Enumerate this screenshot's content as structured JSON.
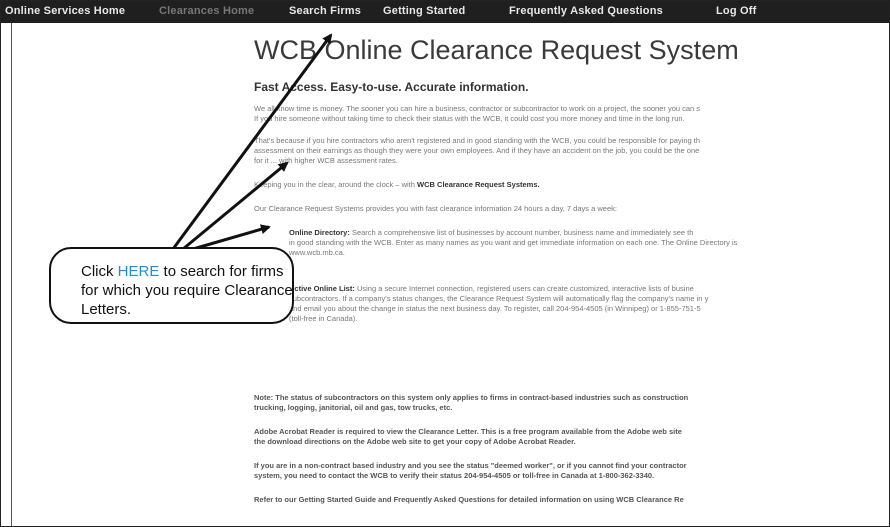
{
  "nav": {
    "items": [
      {
        "label": "Online Services Home",
        "active": false
      },
      {
        "label": "Clearances Home",
        "active": true
      },
      {
        "label": "Search Firms",
        "active": false
      },
      {
        "label": "Getting Started",
        "active": false
      },
      {
        "label": "Frequently Asked Questions",
        "active": false
      },
      {
        "label": "Log Off",
        "active": false
      }
    ]
  },
  "page": {
    "title": "WCB Online Clearance Request System",
    "subtitle": "Fast Access. Easy-to-use. Accurate information.",
    "p1": [
      "We all know time is money. The sooner you can hire a business, contractor or subcontractor to work on a project, the sooner you can s",
      "If you hire someone without taking time to check their status with the WCB, it could cost you more money and time in the long run."
    ],
    "p2": [
      "That's because if you hire contractors who aren't registered and in good standing with the WCB, you could be responsible for paying th",
      "assessment on their earnings as though they were your own employees. And if they have an accident on the job, you could be the one",
      "for it ... with higher WCB assessment rates."
    ],
    "p3_prefix": "Keeping you in the clear, around the clock – with ",
    "p3_bold": "WCB Clearance Request Systems.",
    "p4": "Our Clearance Request Systems provides you with fast clearance information 24 hours a day, 7 days a week:",
    "p5_bold": "Online Directory:",
    "p5": [
      " Search a comprehensive list of businesses by account number, business name and immediately see th",
      "in good standing with the WCB. Enter as many names as you want and get immediate information on each one. The Online Directory is",
      "www.wcb.mb.ca."
    ],
    "p6_bold": "Active Online List:",
    "p6": [
      " Using a secure Internet connection, registered users can create customized, interactive lists of busine",
      "subcontractors. If a company's status changes, the Clearance Request System will automatically flag the company's name in y",
      "and email you about the change in status the next business day. To register, call 204-954-4505 (in Winnipeg) or 1-855-751-5",
      "(toll-free in Canada)."
    ],
    "note": [
      "Note: The status of subcontractors on this system only applies to firms in contract-based industries such as construction",
      "trucking, logging, janitorial, oil and gas, tow trucks, etc."
    ],
    "adobe": [
      "Adobe Acrobat Reader is required to view the Clearance Letter. This is a free program available from the Adobe web site",
      "the download directions on the Adobe web site to get your copy of Adobe Acrobat Reader."
    ],
    "noncontract": [
      "If you are in a non-contract based industry and you see the status \"deemed worker\", or if you cannot find your contractor",
      "system, you need to contact the WCB to verify their status 204-954-4505 or toll-free in Canada at 1-800-362-3340."
    ],
    "refer": "Refer to our Getting Started Guide and Frequently Asked Questions for detailed information on using WCB Clearance Re"
  },
  "callout": {
    "prefix": "Click ",
    "link": "HERE",
    "suffix": " to search for firms for which you require Clearance Letters."
  }
}
